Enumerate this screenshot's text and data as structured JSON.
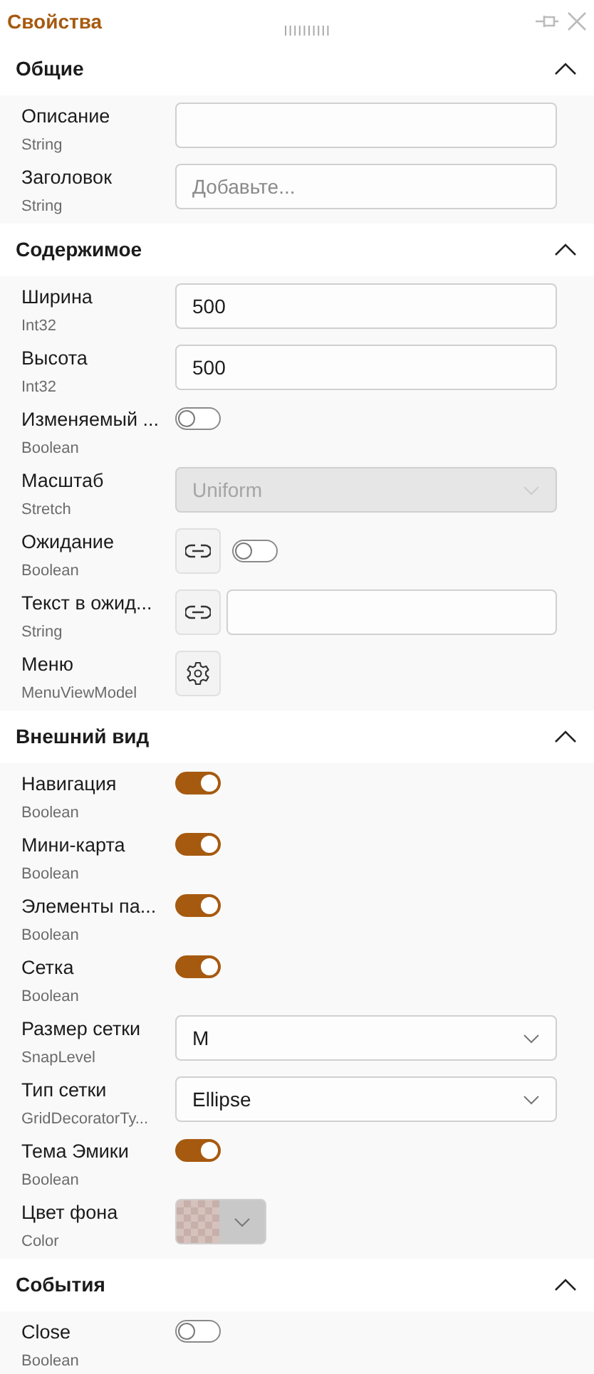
{
  "panel": {
    "title": "Свойства"
  },
  "sections": [
    {
      "title": "Общие",
      "expanded": true,
      "rows": [
        {
          "label": "Описание",
          "type": "String",
          "kind": "text"
        },
        {
          "label": "Заголовок",
          "type": "String",
          "kind": "text",
          "placeholder": "Добавьте..."
        }
      ]
    },
    {
      "title": "Содержимое",
      "expanded": true,
      "rows": [
        {
          "label": "Ширина",
          "type": "Int32",
          "kind": "text",
          "value": "500"
        },
        {
          "label": "Высота",
          "type": "Int32",
          "kind": "text",
          "value": "500"
        },
        {
          "label": "Изменяемый ...",
          "type": "Boolean",
          "kind": "toggle",
          "on": false
        },
        {
          "label": "Масштаб",
          "type": "Stretch",
          "kind": "select",
          "value": "Uniform",
          "disabled": true
        },
        {
          "label": "Ожидание",
          "type": "Boolean",
          "kind": "bound-toggle",
          "on": false
        },
        {
          "label": "Текст в ожид...",
          "type": "String",
          "kind": "bound-text"
        },
        {
          "label": "Меню",
          "type": "MenuViewModel",
          "kind": "settings"
        }
      ]
    },
    {
      "title": "Внешний вид",
      "expanded": true,
      "rows": [
        {
          "label": "Навигация",
          "type": "Boolean",
          "kind": "toggle",
          "on": true
        },
        {
          "label": "Мини-карта",
          "type": "Boolean",
          "kind": "toggle",
          "on": true
        },
        {
          "label": "Элементы па...",
          "type": "Boolean",
          "kind": "toggle",
          "on": true
        },
        {
          "label": "Сетка",
          "type": "Boolean",
          "kind": "toggle",
          "on": true
        },
        {
          "label": "Размер сетки",
          "type": "SnapLevel",
          "kind": "select",
          "value": "M",
          "disabled": false
        },
        {
          "label": "Тип сетки",
          "type": "GridDecoratorTy...",
          "kind": "select",
          "value": "Ellipse",
          "disabled": false
        },
        {
          "label": "Тема Эмики",
          "type": "Boolean",
          "kind": "toggle",
          "on": true
        },
        {
          "label": "Цвет фона",
          "type": "Color",
          "kind": "color"
        }
      ]
    },
    {
      "title": "События",
      "expanded": true,
      "rows": [
        {
          "label": "Close",
          "type": "Boolean",
          "kind": "toggle",
          "on": false
        }
      ]
    }
  ]
}
